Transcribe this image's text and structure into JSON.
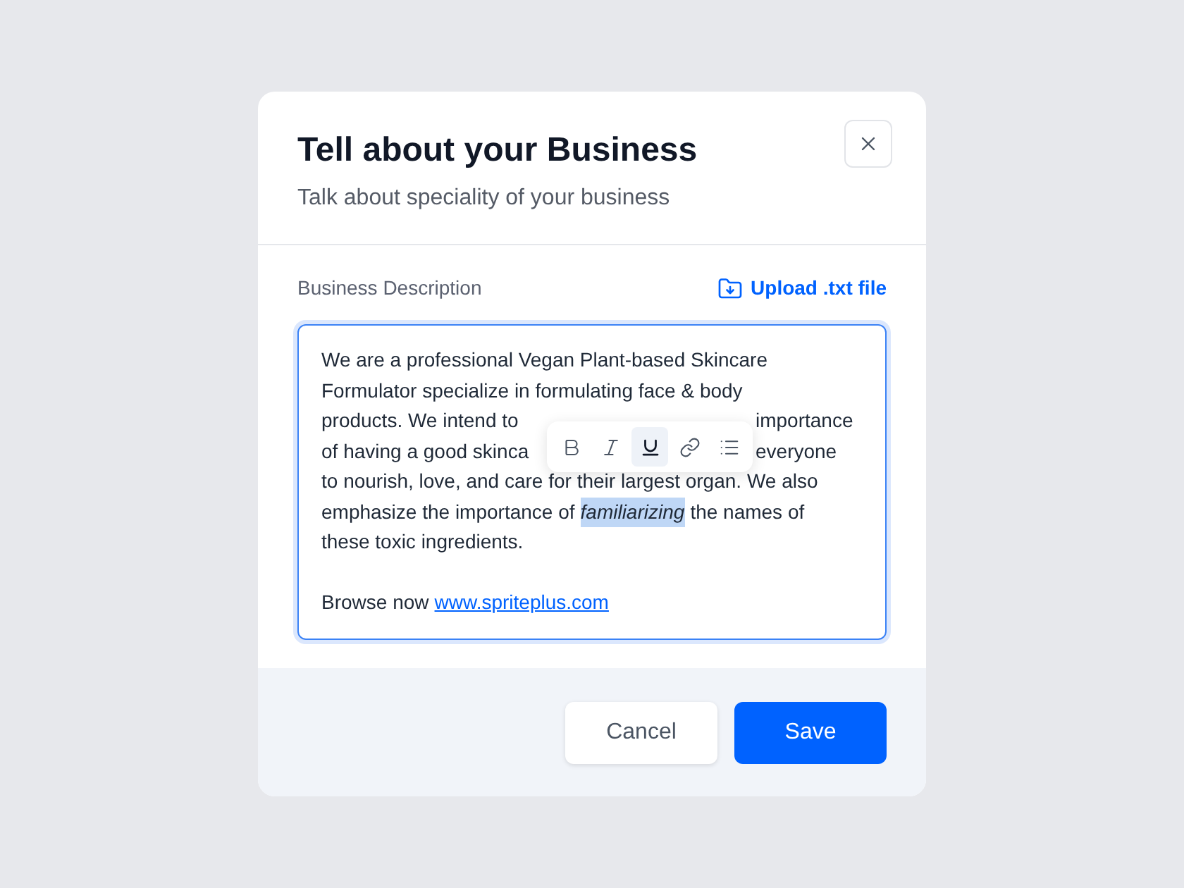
{
  "dialog": {
    "title": "Tell about your Business",
    "subtitle": "Talk about speciality of your business"
  },
  "field": {
    "label": "Business Description",
    "upload_link": "Upload .txt file",
    "paragraphs": [
      {
        "lines": [
          {
            "segments": [
              {
                "kind": "text",
                "text": "We are a professional Vegan Plant-based Skincare"
              }
            ]
          },
          {
            "segments": [
              {
                "kind": "text",
                "text": "Formulator specialize in formulating face & body"
              }
            ]
          },
          {
            "covered": true,
            "segments": [
              {
                "kind": "text",
                "text": "products. We intend to"
              },
              {
                "kind": "text",
                "text": "importance"
              }
            ]
          },
          {
            "covered": true,
            "segments": [
              {
                "kind": "text",
                "text": "of having a good skinca"
              },
              {
                "kind": "text",
                "text": "everyone"
              }
            ]
          },
          {
            "segments": [
              {
                "kind": "text",
                "text": "to nourish, love, and care for their largest organ. We also"
              }
            ]
          },
          {
            "segments": [
              {
                "kind": "text",
                "text": "emphasize the importance of"
              },
              {
                "kind": "selected",
                "text": "familiarizing"
              },
              {
                "kind": "text",
                "text": "the names of"
              }
            ]
          },
          {
            "segments": [
              {
                "kind": "text",
                "text": "these toxic ingredients."
              }
            ]
          }
        ]
      },
      {
        "lines": [
          {
            "segments": [
              {
                "kind": "text",
                "text": "Browse now"
              },
              {
                "kind": "link",
                "text": "www.spriteplus.com"
              }
            ]
          }
        ]
      }
    ]
  },
  "toolbar": [
    {
      "kind": "bold",
      "selected": false
    },
    {
      "kind": "italic",
      "selected": false
    },
    {
      "kind": "underline",
      "selected": true
    },
    {
      "kind": "link",
      "selected": false
    },
    {
      "kind": "list",
      "selected": false
    }
  ],
  "buttons": {
    "cancel": "Cancel",
    "save": "Save"
  }
}
